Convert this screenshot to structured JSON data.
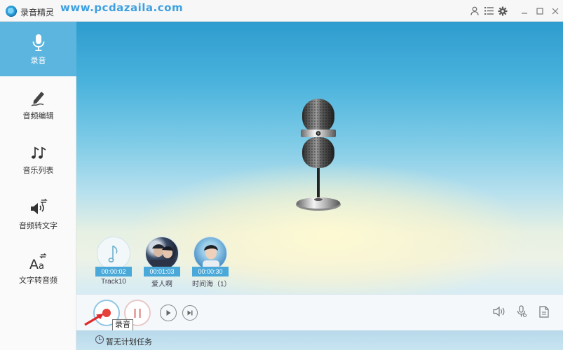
{
  "window": {
    "title": "录音精灵",
    "watermark": "www.pcdazaila.com"
  },
  "sidebar": {
    "items": [
      {
        "label": "录音",
        "icon": "microphone-icon",
        "active": true
      },
      {
        "label": "音频编辑",
        "icon": "pen-icon",
        "active": false
      },
      {
        "label": "音乐列表",
        "icon": "music-notes-icon",
        "active": false
      },
      {
        "label": "音频转文字",
        "icon": "speaker-convert-icon",
        "active": false
      },
      {
        "label": "文字转音频",
        "icon": "text-convert-icon",
        "active": false
      }
    ]
  },
  "tracks": [
    {
      "time": "00:00:02",
      "name": "Track10",
      "thumb": "music-note"
    },
    {
      "time": "00:01:03",
      "name": "爱人啊",
      "thumb": "photo"
    },
    {
      "time": "00:00:30",
      "name": "时间海（1）",
      "thumb": "photo"
    }
  ],
  "controls": {
    "record_tooltip": "录音"
  },
  "status": {
    "text": "暂无计划任务"
  },
  "colors": {
    "accent": "#5cb5de",
    "record": "#e5423b",
    "time_badge": "#4aa9d9"
  }
}
